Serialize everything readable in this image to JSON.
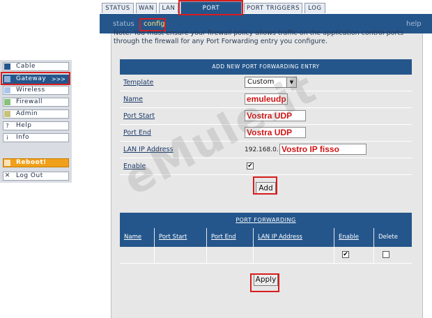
{
  "tabs": [
    {
      "label": "STATUS"
    },
    {
      "label": "WAN"
    },
    {
      "label": "LAN"
    },
    {
      "label": "PORT FORWARDING"
    },
    {
      "label": "PORT TRIGGERS"
    },
    {
      "label": "LOG"
    }
  ],
  "subnav": {
    "status": "status",
    "config": "config",
    "help": "help"
  },
  "note": "Note: You must ensure your firewall policy allows traffic on the application control ports through the firewall for any Port Forwarding entry you configure.",
  "add_panel": {
    "title": "ADD NEW PORT FORWARDING ENTRY",
    "template_label": "Template",
    "template_value": "Custom",
    "name_label": "Name",
    "name_value": "emuleudp",
    "port_start_label": "Port Start",
    "port_start_value": "Vostra UDP",
    "port_end_label": "Port End",
    "port_end_value": "Vostra UDP",
    "lan_ip_label": "LAN IP Address",
    "lan_ip_prefix": "192.168.0.",
    "lan_ip_value": "Vostro IP fisso",
    "enable_label": "Enable",
    "enable_checked": "✔",
    "add_button": "Add"
  },
  "list_panel": {
    "title": "PORT FORWARDING",
    "columns": [
      "Name",
      "Port Start",
      "Port End",
      "LAN IP Address",
      "Enable",
      "Delete"
    ],
    "row_enable_checked": "✔",
    "apply_button": "Apply"
  },
  "sidebar": {
    "items": [
      {
        "label": "Cable",
        "icon": "cable-icon"
      },
      {
        "label": "Gateway",
        "icon": "gateway-icon",
        "chevron": ">>>"
      },
      {
        "label": "Wireless",
        "icon": "wireless-icon"
      },
      {
        "label": "Firewall",
        "icon": "firewall-icon"
      },
      {
        "label": "Admin",
        "icon": "admin-icon"
      },
      {
        "label": "Help",
        "icon": "help-icon",
        "glyph": "?"
      },
      {
        "label": "Info",
        "icon": "info-icon",
        "glyph": "i"
      },
      {
        "label": "Reboot!",
        "icon": "reboot-icon"
      },
      {
        "label": "Log Out",
        "icon": "logout-icon",
        "glyph": "✕"
      }
    ]
  },
  "watermark": "eMule.it",
  "colors": {
    "nav_blue": "#24568c",
    "highlight_red": "#d81c1c",
    "reboot_orange": "#f0a01a"
  }
}
